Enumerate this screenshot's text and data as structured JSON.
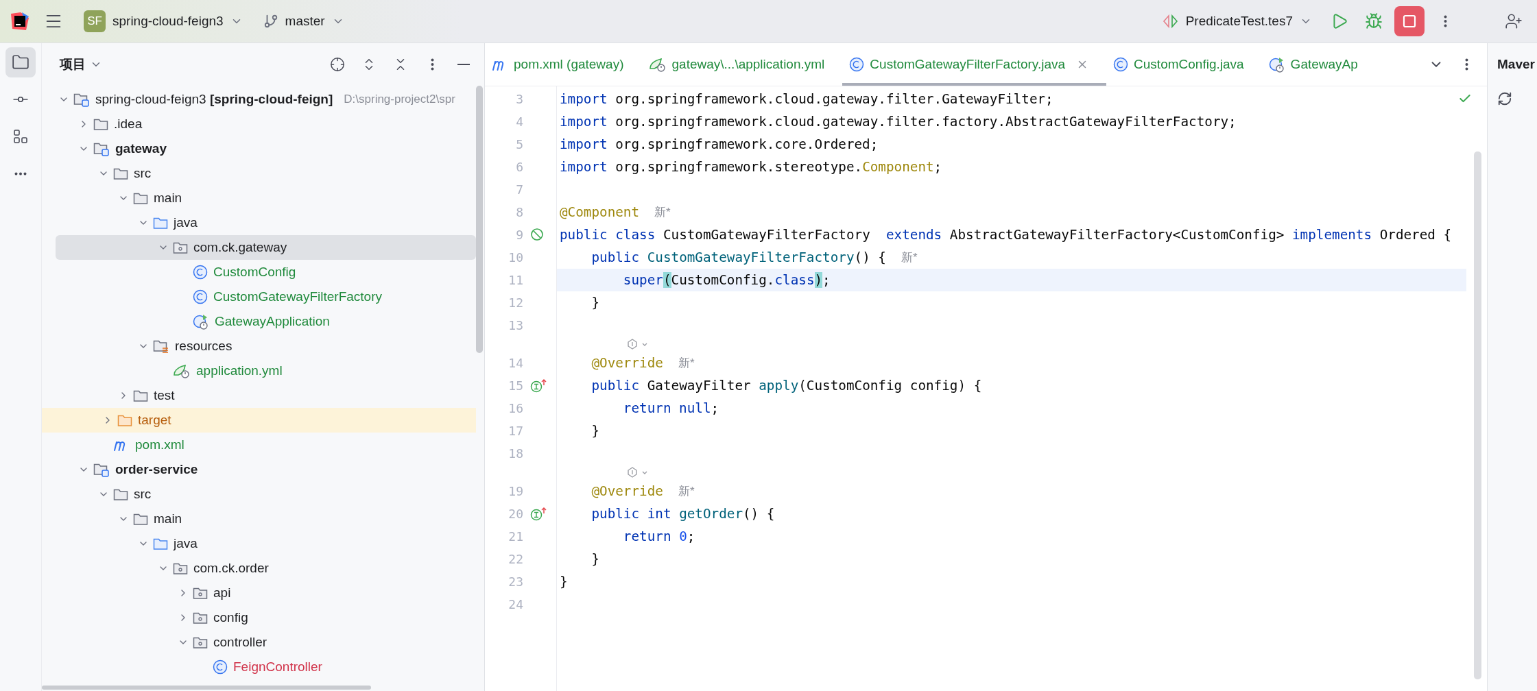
{
  "toolbar": {
    "project": {
      "badge": "SF",
      "name": "spring-cloud-feign3"
    },
    "branch": "master",
    "run_config": "PredicateTest.tes7"
  },
  "tool_strip": [
    {
      "kind": "folder",
      "selected": true
    },
    {
      "kind": "commit",
      "selected": false
    },
    {
      "kind": "structure",
      "selected": false
    },
    {
      "kind": "more",
      "selected": false
    }
  ],
  "project_panel": {
    "title": "项目",
    "tree": [
      {
        "label": "spring-cloud-feign3 **[spring-cloud-feign]**",
        "path": "D:\\spring-project2\\spr",
        "kind": "root",
        "color": "#1e1f22",
        "expanded": true,
        "selected": false,
        "children": [
          {
            "label": ".idea",
            "kind": "folder",
            "color": "#1e1f22",
            "expanded": false,
            "selected": false
          },
          {
            "label": "gateway",
            "kind": "module",
            "color": "#1e1f22",
            "expanded": true,
            "selected": false,
            "children": [
              {
                "label": "src",
                "kind": "folder",
                "color": "#1e1f22",
                "expanded": true,
                "selected": false,
                "children": [
                  {
                    "label": "main",
                    "kind": "folder",
                    "color": "#1e1f22",
                    "expanded": true,
                    "selected": false,
                    "children": [
                      {
                        "label": "java",
                        "kind": "source",
                        "color": "#1e1f22",
                        "expanded": true,
                        "selected": false,
                        "children": [
                          {
                            "label": "com.ck.gateway",
                            "kind": "package",
                            "color": "#1e1f22",
                            "expanded": true,
                            "selected": true,
                            "children": [
                              {
                                "label": "CustomConfig",
                                "kind": "class",
                                "color": "#208a3c",
                                "selected": false
                              },
                              {
                                "label": "CustomGatewayFilterFactory",
                                "kind": "class",
                                "color": "#208a3c",
                                "selected": false
                              },
                              {
                                "label": "GatewayApplication",
                                "kind": "spring-app",
                                "color": "#208a3c",
                                "selected": false
                              }
                            ]
                          }
                        ]
                      },
                      {
                        "label": "resources",
                        "kind": "resources",
                        "color": "#1e1f22",
                        "expanded": true,
                        "selected": false,
                        "children": [
                          {
                            "label": "application.yml",
                            "kind": "spring",
                            "color": "#208a3c",
                            "selected": false
                          }
                        ]
                      }
                    ]
                  },
                  {
                    "label": "test",
                    "kind": "folder",
                    "color": "#1e1f22",
                    "expanded": false,
                    "selected": false
                  }
                ]
              },
              {
                "label": "target",
                "kind": "excluded",
                "color": "#b65d0c",
                "expanded": false,
                "selected": false
              },
              {
                "label": "pom.xml",
                "kind": "maven",
                "color": "#208a3c",
                "selected": false
              }
            ]
          },
          {
            "label": "order-service",
            "kind": "module",
            "color": "#1e1f22",
            "expanded": true,
            "selected": false,
            "children": [
              {
                "label": "src",
                "kind": "folder",
                "color": "#1e1f22",
                "expanded": true,
                "selected": false,
                "children": [
                  {
                    "label": "main",
                    "kind": "folder",
                    "color": "#1e1f22",
                    "expanded": true,
                    "selected": false,
                    "children": [
                      {
                        "label": "java",
                        "kind": "source",
                        "color": "#1e1f22",
                        "expanded": true,
                        "selected": false,
                        "children": [
                          {
                            "label": "com.ck.order",
                            "kind": "package",
                            "color": "#1e1f22",
                            "expanded": true,
                            "selected": false,
                            "children": [
                              {
                                "label": "api",
                                "kind": "package",
                                "color": "#1e1f22",
                                "expanded": false,
                                "selected": false
                              },
                              {
                                "label": "config",
                                "kind": "package",
                                "color": "#1e1f22",
                                "expanded": false,
                                "selected": false
                              },
                              {
                                "label": "controller",
                                "kind": "package",
                                "color": "#1e1f22",
                                "expanded": true,
                                "selected": false,
                                "children": [
                                  {
                                    "label": "FeignController",
                                    "kind": "class",
                                    "color": "#d1334a",
                                    "selected": false
                                  }
                                ]
                              }
                            ]
                          }
                        ]
                      }
                    ]
                  }
                ]
              }
            ]
          }
        ]
      }
    ]
  },
  "editor": {
    "tabs": [
      {
        "label": "pom.xml (gateway)",
        "kind": "maven",
        "selected": false
      },
      {
        "label": "gateway\\...\\application.yml",
        "kind": "spring",
        "selected": false
      },
      {
        "label": "CustomGatewayFilterFactory.java",
        "kind": "class",
        "selected": true
      },
      {
        "label": "CustomConfig.java",
        "kind": "class",
        "selected": false
      },
      {
        "label": "GatewayAp",
        "kind": "spring-app",
        "selected": false
      }
    ],
    "lines": [
      {
        "kind": "code",
        "number": "3",
        "current": false,
        "tokens": [
          {
            "kind": "kw",
            "text": "import"
          },
          {
            "kind": "plain",
            "text": " org.springframework.cloud.gateway.filter.GatewayFilter;"
          }
        ]
      },
      {
        "kind": "code",
        "number": "4",
        "current": false,
        "tokens": [
          {
            "kind": "kw",
            "text": "import"
          },
          {
            "kind": "plain",
            "text": " org.springframework.cloud.gateway.filter.factory.AbstractGatewayFilterFactory;"
          }
        ]
      },
      {
        "kind": "code",
        "number": "5",
        "current": false,
        "tokens": [
          {
            "kind": "kw",
            "text": "import"
          },
          {
            "kind": "plain",
            "text": " org.springframework.core.Ordered;"
          }
        ]
      },
      {
        "kind": "code",
        "number": "6",
        "current": false,
        "tokens": [
          {
            "kind": "kw",
            "text": "import"
          },
          {
            "kind": "plain",
            "text": " org.springframework.stereotype."
          },
          {
            "kind": "ann",
            "text": "Component"
          },
          {
            "kind": "plain",
            "text": ";"
          }
        ]
      },
      {
        "kind": "code",
        "number": "7",
        "current": false
      },
      {
        "kind": "code",
        "number": "8",
        "current": false,
        "hint": "新*",
        "tokens": [
          {
            "kind": "ann",
            "text": "@Component"
          }
        ]
      },
      {
        "kind": "code",
        "number": "9",
        "current": false,
        "marker": {
          "kind": "bean"
        },
        "tokens": [
          {
            "kind": "kw",
            "text": "public class"
          },
          {
            "kind": "plain",
            "text": " CustomGatewayFilterFactory  "
          },
          {
            "kind": "kw",
            "text": "extends"
          },
          {
            "kind": "plain",
            "text": " AbstractGatewayFilterFactory<CustomConfig> "
          },
          {
            "kind": "kw",
            "text": "implements"
          },
          {
            "kind": "plain",
            "text": " Ordered {"
          }
        ]
      },
      {
        "kind": "code",
        "number": "10",
        "current": false,
        "hint": "新*",
        "tokens": [
          {
            "kind": "kw",
            "text": "    public "
          },
          {
            "kind": "decl",
            "text": "CustomGatewayFilterFactory"
          },
          {
            "kind": "plain",
            "text": "() {"
          }
        ]
      },
      {
        "kind": "code",
        "number": "11",
        "current": true,
        "tokens": [
          {
            "kind": "kw",
            "text": "        super"
          },
          {
            "kind": "match",
            "text": "("
          },
          {
            "kind": "plain",
            "text": "CustomConfig."
          },
          {
            "kind": "kw",
            "text": "class"
          },
          {
            "kind": "match",
            "text": ")"
          },
          {
            "kind": "plain",
            "text": ";"
          }
        ]
      },
      {
        "kind": "code",
        "number": "12",
        "current": false,
        "tokens": [
          {
            "kind": "plain",
            "text": "    }"
          }
        ]
      },
      {
        "kind": "code",
        "number": "13",
        "current": false
      },
      {
        "kind": "inlay",
        "current": false
      },
      {
        "kind": "code",
        "number": "14",
        "current": false,
        "hint": "新*",
        "tokens": [
          {
            "kind": "ann",
            "text": "    @Override"
          }
        ]
      },
      {
        "kind": "code",
        "number": "15",
        "current": false,
        "marker": {
          "kind": "override"
        },
        "tokens": [
          {
            "kind": "kw",
            "text": "    public"
          },
          {
            "kind": "plain",
            "text": " GatewayFilter "
          },
          {
            "kind": "decl",
            "text": "apply"
          },
          {
            "kind": "plain",
            "text": "(CustomConfig config) {"
          }
        ]
      },
      {
        "kind": "code",
        "number": "16",
        "current": false,
        "tokens": [
          {
            "kind": "kw",
            "text": "        return null"
          },
          {
            "kind": "plain",
            "text": ";"
          }
        ]
      },
      {
        "kind": "code",
        "number": "17",
        "current": false,
        "tokens": [
          {
            "kind": "plain",
            "text": "    }"
          }
        ]
      },
      {
        "kind": "code",
        "number": "18",
        "current": false
      },
      {
        "kind": "inlay",
        "current": false
      },
      {
        "kind": "code",
        "number": "19",
        "current": false,
        "hint": "新*",
        "tokens": [
          {
            "kind": "ann",
            "text": "    @Override"
          }
        ]
      },
      {
        "kind": "code",
        "number": "20",
        "current": false,
        "marker": {
          "kind": "override"
        },
        "tokens": [
          {
            "kind": "kw",
            "text": "    public int "
          },
          {
            "kind": "decl",
            "text": "getOrder"
          },
          {
            "kind": "plain",
            "text": "() {"
          }
        ]
      },
      {
        "kind": "code",
        "number": "21",
        "current": false,
        "tokens": [
          {
            "kind": "kw",
            "text": "        return "
          },
          {
            "kind": "num",
            "text": "0"
          },
          {
            "kind": "plain",
            "text": ";"
          }
        ]
      },
      {
        "kind": "code",
        "number": "22",
        "current": false,
        "tokens": [
          {
            "kind": "plain",
            "text": "    }"
          }
        ]
      },
      {
        "kind": "code",
        "number": "23",
        "current": false,
        "tokens": [
          {
            "kind": "plain",
            "text": "}"
          }
        ]
      },
      {
        "kind": "code",
        "number": "24",
        "current": false
      }
    ]
  },
  "maven_panel": {
    "title": "Maver"
  }
}
